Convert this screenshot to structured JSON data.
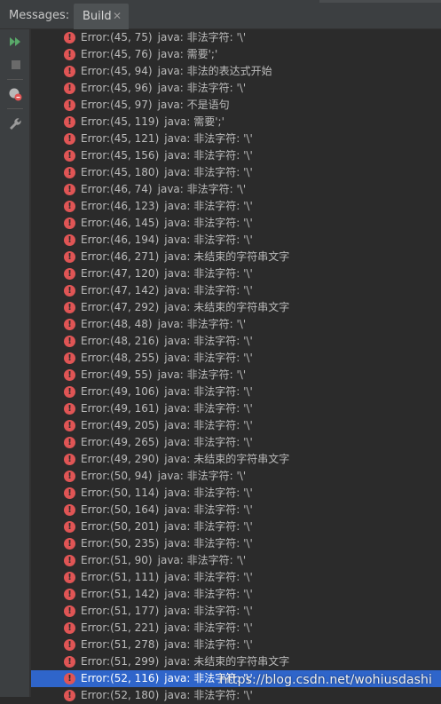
{
  "panel": {
    "title": "Messages:",
    "tabs": [
      {
        "label": "Build",
        "close_icon": "close-icon",
        "active": true
      }
    ]
  },
  "toolbar": {
    "buttons": [
      {
        "icon": "rerun-icon",
        "color": "#59a869"
      },
      {
        "icon": "stop-icon",
        "color": "#6a6a6a"
      },
      {
        "icon": "error-filter-icon",
        "color": "#e05555"
      },
      {
        "icon": "wrench-icon",
        "color": "#9a9a9a"
      }
    ]
  },
  "messages": [
    {
      "location": "Error:(45, 75)",
      "text": "java: 非法字符: '\\'"
    },
    {
      "location": "Error:(45, 76)",
      "text": "java: 需要';'"
    },
    {
      "location": "Error:(45, 94)",
      "text": "java: 非法的表达式开始"
    },
    {
      "location": "Error:(45, 96)",
      "text": "java: 非法字符: '\\'"
    },
    {
      "location": "Error:(45, 97)",
      "text": "java: 不是语句"
    },
    {
      "location": "Error:(45, 119)",
      "text": "java: 需要';'"
    },
    {
      "location": "Error:(45, 121)",
      "text": "java: 非法字符: '\\'"
    },
    {
      "location": "Error:(45, 156)",
      "text": "java: 非法字符: '\\'"
    },
    {
      "location": "Error:(45, 180)",
      "text": "java: 非法字符: '\\'"
    },
    {
      "location": "Error:(46, 74)",
      "text": "java: 非法字符: '\\'"
    },
    {
      "location": "Error:(46, 123)",
      "text": "java: 非法字符: '\\'"
    },
    {
      "location": "Error:(46, 145)",
      "text": "java: 非法字符: '\\'"
    },
    {
      "location": "Error:(46, 194)",
      "text": "java: 非法字符: '\\'"
    },
    {
      "location": "Error:(46, 271)",
      "text": "java: 未结束的字符串文字"
    },
    {
      "location": "Error:(47, 120)",
      "text": "java: 非法字符: '\\'"
    },
    {
      "location": "Error:(47, 142)",
      "text": "java: 非法字符: '\\'"
    },
    {
      "location": "Error:(47, 292)",
      "text": "java: 未结束的字符串文字"
    },
    {
      "location": "Error:(48, 48)",
      "text": "java: 非法字符: '\\'"
    },
    {
      "location": "Error:(48, 216)",
      "text": "java: 非法字符: '\\'"
    },
    {
      "location": "Error:(48, 255)",
      "text": "java: 非法字符: '\\'"
    },
    {
      "location": "Error:(49, 55)",
      "text": "java: 非法字符: '\\'"
    },
    {
      "location": "Error:(49, 106)",
      "text": "java: 非法字符: '\\'"
    },
    {
      "location": "Error:(49, 161)",
      "text": "java: 非法字符: '\\'"
    },
    {
      "location": "Error:(49, 205)",
      "text": "java: 非法字符: '\\'"
    },
    {
      "location": "Error:(49, 265)",
      "text": "java: 非法字符: '\\'"
    },
    {
      "location": "Error:(49, 290)",
      "text": "java: 未结束的字符串文字"
    },
    {
      "location": "Error:(50, 94)",
      "text": "java: 非法字符: '\\'"
    },
    {
      "location": "Error:(50, 114)",
      "text": "java: 非法字符: '\\'"
    },
    {
      "location": "Error:(50, 164)",
      "text": "java: 非法字符: '\\'"
    },
    {
      "location": "Error:(50, 201)",
      "text": "java: 非法字符: '\\'"
    },
    {
      "location": "Error:(50, 235)",
      "text": "java: 非法字符: '\\'"
    },
    {
      "location": "Error:(51, 90)",
      "text": "java: 非法字符: '\\'"
    },
    {
      "location": "Error:(51, 111)",
      "text": "java: 非法字符: '\\'"
    },
    {
      "location": "Error:(51, 142)",
      "text": "java: 非法字符: '\\'"
    },
    {
      "location": "Error:(51, 177)",
      "text": "java: 非法字符: '\\'"
    },
    {
      "location": "Error:(51, 221)",
      "text": "java: 非法字符: '\\'"
    },
    {
      "location": "Error:(51, 278)",
      "text": "java: 非法字符: '\\'"
    },
    {
      "location": "Error:(51, 299)",
      "text": "java: 未结束的字符串文字"
    },
    {
      "location": "Error:(52, 116)",
      "text": "java: 非法字符: '\\'",
      "selected": true
    },
    {
      "location": "Error:(52, 180)",
      "text": "java: 非法字符: '\\'"
    }
  ],
  "watermark": "https://blog.csdn.net/wohiusdashi",
  "colors": {
    "background": "#2b2b2b",
    "panel": "#3c3f41",
    "selection": "#2f65ca",
    "error": "#e05555"
  }
}
